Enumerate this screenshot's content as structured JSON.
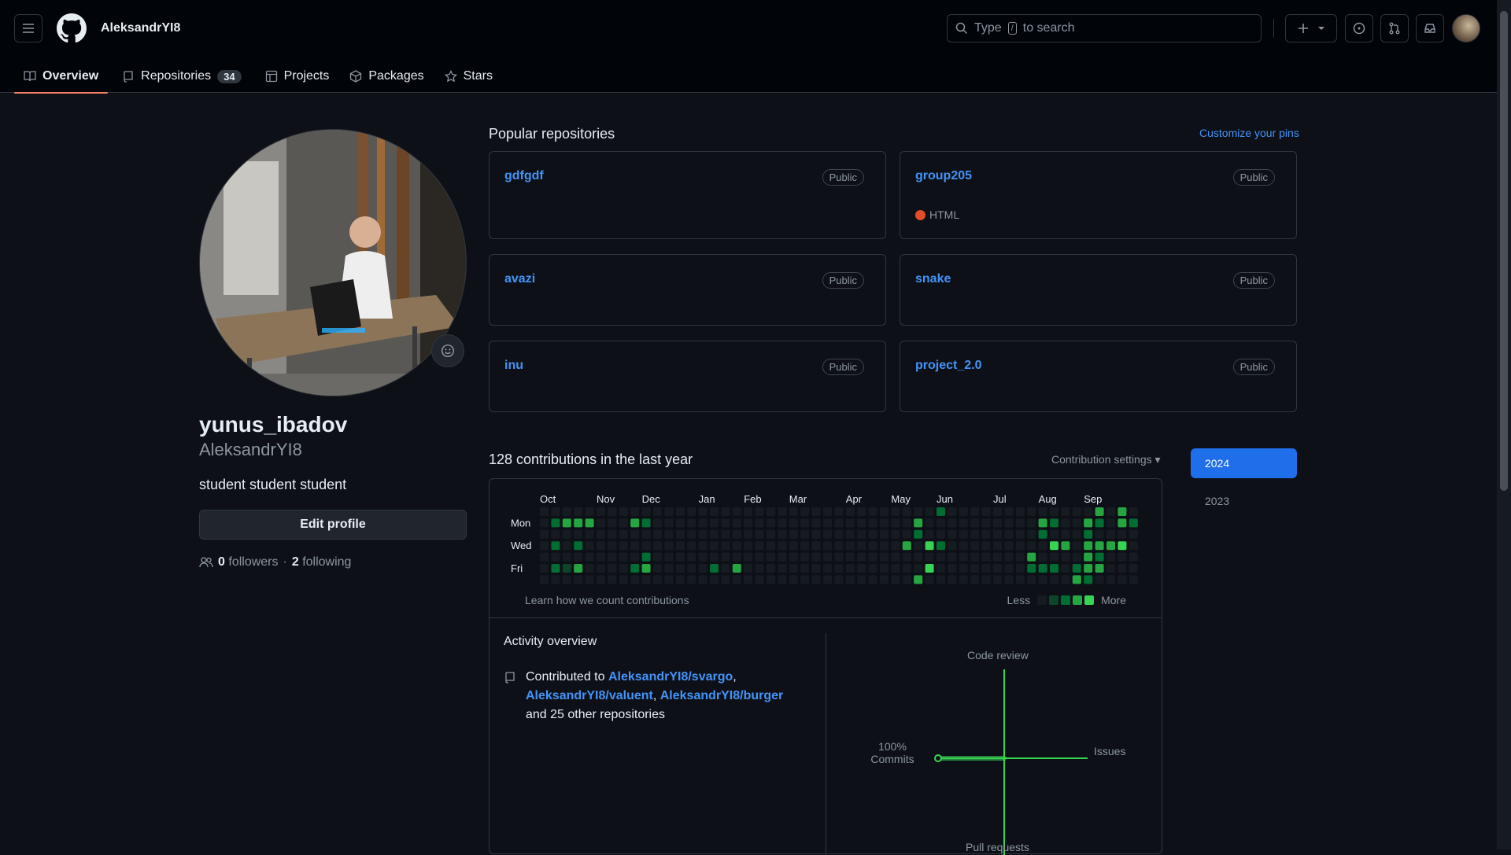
{
  "header": {
    "username": "AleksandrYI8",
    "search_placeholder_before": "Type",
    "search_slash": "/",
    "search_placeholder_after": "to search"
  },
  "tabs": [
    {
      "label": "Overview",
      "icon": "book-icon",
      "active": true
    },
    {
      "label": "Repositories",
      "icon": "repo-icon",
      "count": "34"
    },
    {
      "label": "Projects",
      "icon": "table-icon"
    },
    {
      "label": "Packages",
      "icon": "package-icon"
    },
    {
      "label": "Stars",
      "icon": "star-icon"
    }
  ],
  "profile": {
    "name": "yunus_ibadov",
    "login": "AleksandrYI8",
    "bio": "student student student",
    "edit_label": "Edit profile",
    "followers": "0",
    "followers_label": "followers",
    "dot": "·",
    "following": "2",
    "following_label": "following"
  },
  "popular": {
    "title": "Popular repositories",
    "customize": "Customize your pins",
    "repos": [
      {
        "name": "gdfgdf",
        "visibility": "Public"
      },
      {
        "name": "group205",
        "visibility": "Public",
        "language": "HTML",
        "language_color": "#e34c26"
      },
      {
        "name": "avazi",
        "visibility": "Public"
      },
      {
        "name": "snake",
        "visibility": "Public"
      },
      {
        "name": "inu",
        "visibility": "Public"
      },
      {
        "name": "project_2.0",
        "visibility": "Public"
      }
    ]
  },
  "contributions": {
    "title": "128 contributions in the last year",
    "settings": "Contribution settings ▾",
    "years": [
      "2024",
      "2023"
    ],
    "months": [
      "Oct",
      "Nov",
      "Dec",
      "Jan",
      "Feb",
      "Mar",
      "Apr",
      "May",
      "Jun",
      "Jul",
      "Aug",
      "Sep"
    ],
    "day_labels": [
      "Mon",
      "Wed",
      "Fri"
    ],
    "learn": "Learn how we count contributions",
    "less": "Less",
    "more": "More",
    "colors": [
      "#161b22",
      "#0e4429",
      "#006d32",
      "#26a641",
      "#39d353"
    ],
    "active_cells": [
      [
        1,
        1,
        2
      ],
      [
        1,
        3,
        2
      ],
      [
        1,
        5,
        2
      ],
      [
        2,
        1,
        3
      ],
      [
        2,
        5,
        1
      ],
      [
        3,
        1,
        3
      ],
      [
        3,
        3,
        2
      ],
      [
        3,
        5,
        3
      ],
      [
        4,
        1,
        3
      ],
      [
        8,
        1,
        3
      ],
      [
        8,
        5,
        2
      ],
      [
        9,
        1,
        2
      ],
      [
        9,
        4,
        2
      ],
      [
        9,
        5,
        3
      ],
      [
        15,
        5,
        2
      ],
      [
        17,
        5,
        3
      ],
      [
        32,
        3,
        3
      ],
      [
        33,
        1,
        3
      ],
      [
        33,
        2,
        2
      ],
      [
        33,
        6,
        3
      ],
      [
        34,
        3,
        4
      ],
      [
        34,
        5,
        4
      ],
      [
        35,
        0,
        2
      ],
      [
        35,
        3,
        2
      ],
      [
        43,
        4,
        3
      ],
      [
        43,
        5,
        2
      ],
      [
        44,
        1,
        3
      ],
      [
        44,
        2,
        2
      ],
      [
        44,
        5,
        2
      ],
      [
        45,
        1,
        2
      ],
      [
        45,
        3,
        4
      ],
      [
        45,
        5,
        2
      ],
      [
        46,
        3,
        3
      ],
      [
        47,
        5,
        2
      ],
      [
        47,
        6,
        3
      ],
      [
        48,
        1,
        3
      ],
      [
        48,
        2,
        2
      ],
      [
        48,
        3,
        3
      ],
      [
        48,
        4,
        3
      ],
      [
        48,
        5,
        3
      ],
      [
        48,
        6,
        2
      ],
      [
        49,
        0,
        3
      ],
      [
        49,
        1,
        2
      ],
      [
        49,
        3,
        3
      ],
      [
        49,
        4,
        2
      ],
      [
        49,
        5,
        3
      ],
      [
        50,
        3,
        3
      ],
      [
        51,
        0,
        3
      ],
      [
        51,
        1,
        3
      ],
      [
        51,
        3,
        4
      ],
      [
        52,
        1,
        2
      ]
    ]
  },
  "activity": {
    "title": "Activity overview",
    "contributed_to": "Contributed to",
    "repo1": "AleksandrYI8/svargo",
    "comma1": ",",
    "repo2": "AleksandrYI8/valuent",
    "comma2": ",",
    "repo3": "AleksandrYI8/burger",
    "others": "and 25 other repositories",
    "axis": {
      "top": "Code review",
      "right": "Issues",
      "bottom": "Pull requests",
      "left_pct": "100%",
      "left": "Commits"
    },
    "commits_fraction": 1.0,
    "accent": "#39d353"
  }
}
